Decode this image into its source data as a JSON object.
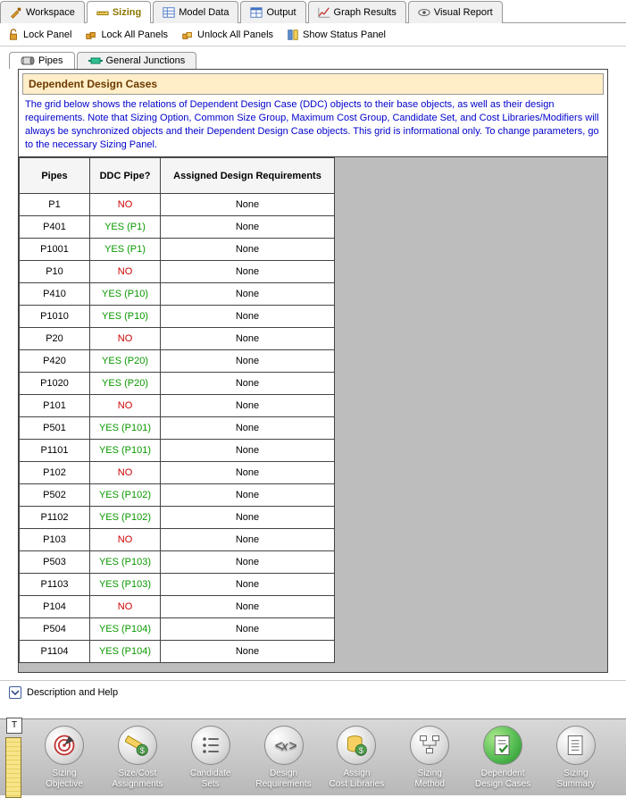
{
  "top_tabs": [
    {
      "label": "Workspace",
      "icon": "workspace"
    },
    {
      "label": "Sizing",
      "icon": "sizing",
      "active": true
    },
    {
      "label": "Model Data",
      "icon": "modeldata"
    },
    {
      "label": "Output",
      "icon": "output"
    },
    {
      "label": "Graph Results",
      "icon": "graph"
    },
    {
      "label": "Visual Report",
      "icon": "visual"
    }
  ],
  "lock_bar": {
    "lock_panel": "Lock Panel",
    "lock_all": "Lock All Panels",
    "unlock_all": "Unlock All Panels",
    "show_status": "Show Status Panel"
  },
  "inner_tabs": {
    "pipes": "Pipes",
    "junctions": "General Junctions"
  },
  "panel": {
    "header": "Dependent Design Cases",
    "info": "The grid below shows the relations of Dependent Design Case (DDC) objects to their base objects, as well as their design requirements. Note that Sizing Option, Common Size Group, Maximum Cost Group, Candidate Set, and Cost Libraries/Modifiers will always be synchronized objects and their Dependent Design Case objects. This grid is informational only. To change parameters, go to the necessary Sizing Panel."
  },
  "grid": {
    "headers": {
      "pipes": "Pipes",
      "ddc": "DDC Pipe?",
      "req": "Assigned Design Requirements"
    },
    "rows": [
      {
        "pipe": "P1",
        "ddc": "NO",
        "ddc_yes": false,
        "req": "None",
        "grp_start": true
      },
      {
        "pipe": "P401",
        "ddc": "YES (P1)",
        "ddc_yes": true,
        "req": "None"
      },
      {
        "pipe": "P1001",
        "ddc": "YES (P1)",
        "ddc_yes": true,
        "req": "None"
      },
      {
        "pipe": "P10",
        "ddc": "NO",
        "ddc_yes": false,
        "req": "None",
        "grp_start": true
      },
      {
        "pipe": "P410",
        "ddc": "YES (P10)",
        "ddc_yes": true,
        "req": "None"
      },
      {
        "pipe": "P1010",
        "ddc": "YES (P10)",
        "ddc_yes": true,
        "req": "None"
      },
      {
        "pipe": "P20",
        "ddc": "NO",
        "ddc_yes": false,
        "req": "None",
        "grp_start": true
      },
      {
        "pipe": "P420",
        "ddc": "YES (P20)",
        "ddc_yes": true,
        "req": "None"
      },
      {
        "pipe": "P1020",
        "ddc": "YES (P20)",
        "ddc_yes": true,
        "req": "None"
      },
      {
        "pipe": "P101",
        "ddc": "NO",
        "ddc_yes": false,
        "req": "None",
        "grp_start": true
      },
      {
        "pipe": "P501",
        "ddc": "YES (P101)",
        "ddc_yes": true,
        "req": "None"
      },
      {
        "pipe": "P1101",
        "ddc": "YES (P101)",
        "ddc_yes": true,
        "req": "None"
      },
      {
        "pipe": "P102",
        "ddc": "NO",
        "ddc_yes": false,
        "req": "None",
        "grp_start": true
      },
      {
        "pipe": "P502",
        "ddc": "YES (P102)",
        "ddc_yes": true,
        "req": "None"
      },
      {
        "pipe": "P1102",
        "ddc": "YES (P102)",
        "ddc_yes": true,
        "req": "None"
      },
      {
        "pipe": "P103",
        "ddc": "NO",
        "ddc_yes": false,
        "req": "None",
        "grp_start": true
      },
      {
        "pipe": "P503",
        "ddc": "YES (P103)",
        "ddc_yes": true,
        "req": "None"
      },
      {
        "pipe": "P1103",
        "ddc": "YES (P103)",
        "ddc_yes": true,
        "req": "None"
      },
      {
        "pipe": "P104",
        "ddc": "NO",
        "ddc_yes": false,
        "req": "None",
        "grp_start": true
      },
      {
        "pipe": "P504",
        "ddc": "YES (P104)",
        "ddc_yes": true,
        "req": "None"
      },
      {
        "pipe": "P1104",
        "ddc": "YES (P104)",
        "ddc_yes": true,
        "req": "None"
      }
    ]
  },
  "desc_bar": {
    "label": "Description and Help"
  },
  "bottom_nav": [
    {
      "label1": "Sizing",
      "label2": "Objective",
      "icon": "target"
    },
    {
      "label1": "Size/Cost",
      "label2": "Assignments",
      "icon": "ruler-dollar"
    },
    {
      "label1": "Candidate",
      "label2": "Sets",
      "icon": "list"
    },
    {
      "label1": "Design",
      "label2": "Requirements",
      "icon": "angle-x"
    },
    {
      "label1": "Assign",
      "label2": "Cost Libraries",
      "icon": "db-dollar"
    },
    {
      "label1": "Sizing",
      "label2": "Method",
      "icon": "flow"
    },
    {
      "label1": "Dependent",
      "label2": "Design Cases",
      "icon": "doc-check",
      "active": true
    },
    {
      "label1": "Sizing",
      "label2": "Summary",
      "icon": "doc-lines"
    }
  ]
}
